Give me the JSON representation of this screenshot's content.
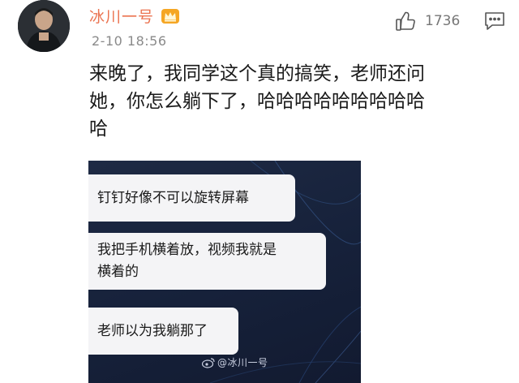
{
  "comment": {
    "username": "冰川一号",
    "badge_icon": "crown-vip-icon",
    "time": "2-10 18:56",
    "like_count": "1736",
    "text_lines": [
      "来晚了，我同学这个真的搞笑，老师还问",
      "她，你怎么躺下了，哈哈哈哈哈哈哈哈哈",
      "哈"
    ]
  },
  "attachment": {
    "bubbles": [
      "钉钉好像不可以旋转屏幕",
      "我把手机横着放，视频我就是",
      "横着的",
      "老师以为我躺那了"
    ],
    "watermark": "@冰川一号"
  },
  "colors": {
    "username": "#eb7350",
    "meta": "#8a8a8a",
    "screenshot_bg": "#16213a",
    "bubble_bg": "#f4f4f6"
  }
}
